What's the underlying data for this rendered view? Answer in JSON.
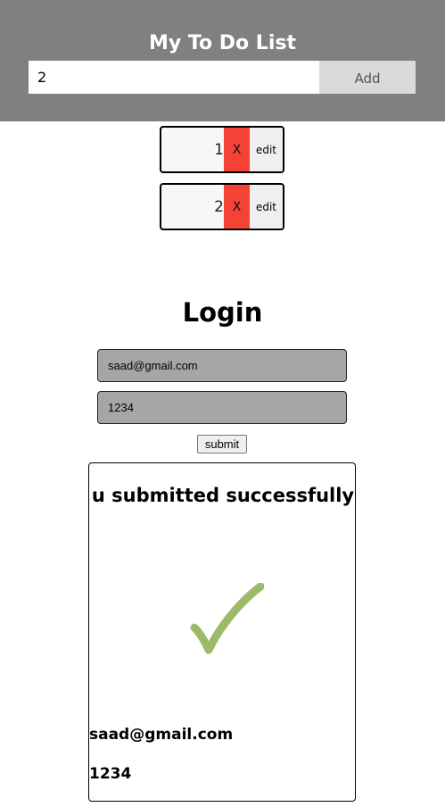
{
  "header": {
    "title": "My To Do List",
    "input_value": "2",
    "add_label": "Add"
  },
  "todos": [
    {
      "text": "1",
      "delete_label": "X",
      "edit_label": "edit"
    },
    {
      "text": "2",
      "delete_label": "X",
      "edit_label": "edit"
    }
  ],
  "login": {
    "title": "Login",
    "email_value": "saad@gmail.com",
    "password_value": "1234",
    "submit_label": "submit"
  },
  "result": {
    "message": "u submitted successfully",
    "check_icon": "checkmark-icon",
    "check_color": "#9bbb6b",
    "email": "saad@gmail.com",
    "password": "1234"
  },
  "colors": {
    "header_bg": "#808080",
    "delete_bg": "#f44336",
    "field_bg": "#a6a6a6"
  }
}
